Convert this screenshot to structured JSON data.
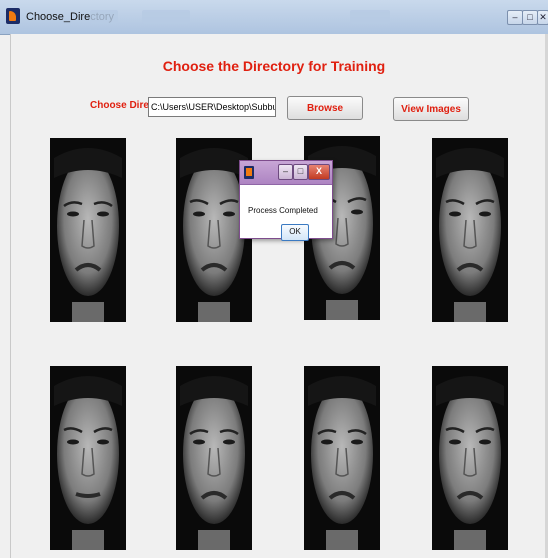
{
  "window": {
    "title": "Choose_Directory",
    "controls": [
      "–",
      "□",
      "✕"
    ]
  },
  "heading": "Choose the Directory for Training",
  "directory": {
    "label": "Choose Directory",
    "value": "C:\\Users\\USER\\Desktop\\SubbuNewFinal"
  },
  "buttons": {
    "browse": "Browse",
    "view_images": "View Images"
  },
  "dialog": {
    "message": "Process Completed",
    "ok": "OK",
    "controls": [
      "–",
      "□",
      "X"
    ]
  },
  "images": [
    {
      "expression": "frown"
    },
    {
      "expression": "sad"
    },
    {
      "expression": "worried"
    },
    {
      "expression": "pout"
    },
    {
      "expression": "neutral"
    },
    {
      "expression": "disgust"
    },
    {
      "expression": "angry"
    },
    {
      "expression": "sad"
    }
  ],
  "colors": {
    "accent": "#e02010",
    "titlebar": "#aec4e0",
    "dialog_titlebar": "#ad84c2"
  }
}
